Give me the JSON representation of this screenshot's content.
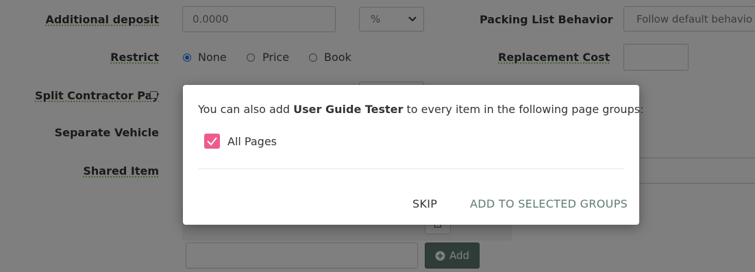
{
  "form": {
    "additional_deposit": {
      "label": "Additional deposit",
      "value": "0.0000",
      "unit": "%"
    },
    "packing_list": {
      "label": "Packing List Behavior",
      "value": "Follow default behavio"
    },
    "restrict": {
      "label": "Restrict",
      "options": [
        "None",
        "Price",
        "Book"
      ],
      "selected": "None"
    },
    "replacement_cost": {
      "label": "Replacement Cost",
      "value": ""
    },
    "split_contractor_pay": {
      "label": "Split Contractor Pay"
    },
    "separate_vehicle": {
      "label": "Separate Vehicle"
    },
    "shared_item": {
      "label": "Shared Item"
    },
    "group_row_text": "User Guide Tester",
    "add_input": {
      "value": ""
    },
    "add_button": {
      "label": "Add",
      "icon": "plus-circle-icon"
    }
  },
  "modal": {
    "message_prefix": "You can also add ",
    "message_bold": "User Guide Tester",
    "message_suffix": " to every item in the following page groups:",
    "checkbox_label": "All Pages",
    "checkbox_checked": true,
    "skip_label": "SKIP",
    "add_label": "ADD TO SELECTED GROUPS"
  },
  "colors": {
    "checkbox_pink": "#ee5b8e",
    "add_button_bg": "#5f7a70",
    "primary_text_button": "#5f7a70",
    "radio_selected": "#1a73e8",
    "underline_green": "#6bb84a"
  }
}
